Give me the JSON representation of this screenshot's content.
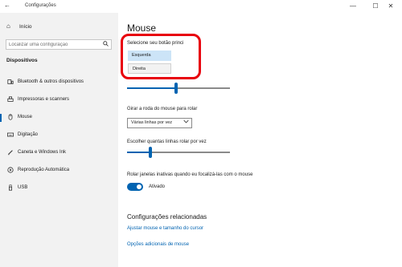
{
  "window": {
    "title": "Configurações",
    "back_icon": "back-arrow-icon",
    "controls": {
      "minimize": "—",
      "maximize": "☐",
      "close": "✕"
    }
  },
  "sidebar": {
    "home": {
      "label": "Início",
      "icon": "home-icon"
    },
    "search": {
      "placeholder": "Localizar uma configuração",
      "icon": "search-icon"
    },
    "section": "Dispositivos",
    "items": [
      {
        "label": "Bluetooth & outros dispositivos",
        "icon": "bluetooth-devices-icon",
        "selected": false
      },
      {
        "label": "Impressoras e scanners",
        "icon": "printer-icon",
        "selected": false
      },
      {
        "label": "Mouse",
        "icon": "mouse-icon",
        "selected": true
      },
      {
        "label": "Digitação",
        "icon": "keyboard-icon",
        "selected": false
      },
      {
        "label": "Caneta e Windows Ink",
        "icon": "pen-icon",
        "selected": false
      },
      {
        "label": "Reprodução Automática",
        "icon": "autoplay-icon",
        "selected": false
      },
      {
        "label": "USB",
        "icon": "usb-icon",
        "selected": false
      }
    ]
  },
  "main": {
    "title": "Mouse",
    "primary_button": {
      "label": "Selecione seu botão princi",
      "options": [
        "Esquerda",
        "Direita"
      ],
      "selected": "Esquerda"
    },
    "cursor_speed": {
      "value_fraction": 0.48
    },
    "wheel": {
      "label": "Girar a roda do mouse para rolar",
      "value": "Várias linhas por vez"
    },
    "lines": {
      "label": "Escolher quantas linhas rolar por vez",
      "value_fraction": 0.23
    },
    "inactive_scroll": {
      "label": "Rolar janelas inativas quando eu focalizá-las com o mouse",
      "state": "Ativado",
      "on": true
    },
    "related": {
      "title": "Configurações relacionadas",
      "links": [
        "Ajustar mouse e tamanho do cursor",
        "Opções adicionais de mouse"
      ]
    }
  },
  "colors": {
    "accent": "#0063b1",
    "highlight": "#e8000b",
    "selected_option": "#cce4f7",
    "sidebar_bg": "#f2f2f2"
  }
}
